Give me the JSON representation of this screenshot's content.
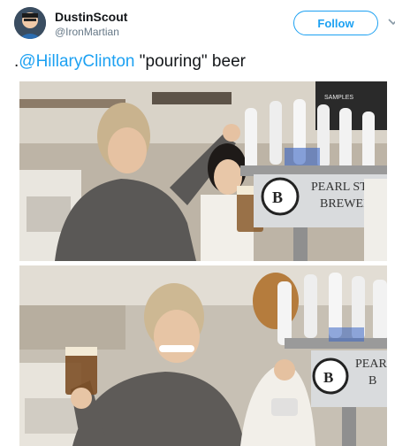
{
  "user": {
    "display_name": "DustinScout",
    "handle": "@IronMartian",
    "avatar_icon": "avatar-icon"
  },
  "actions": {
    "follow_label": "Follow",
    "more_icon": "chevron-down-icon"
  },
  "tweet": {
    "prefix": ".",
    "mention": "@HillaryClinton",
    "rest": " \"pouring\" beer"
  },
  "media": {
    "photos": [
      {
        "tap_sign": "PEARL ST",
        "tap_sign_2": "BREWER"
      },
      {
        "tap_sign": "PEAR",
        "tap_sign_2": "B"
      }
    ],
    "menu_board": "SAMPLES"
  },
  "colors": {
    "accent": "#1da1f2",
    "text": "#14171a",
    "muted": "#657786"
  }
}
